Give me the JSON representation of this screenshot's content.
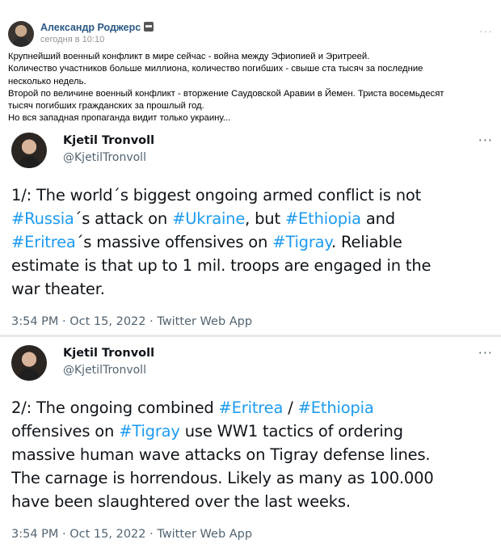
{
  "post": {
    "author": "Александр Роджерс",
    "time": "сегодня в 10:10",
    "more": "···",
    "text": [
      "Крупнейший военный конфликт в мире сейчас - война между Эфиопией и Эритреей.",
      "Количество участников больше миллиона, количество погибших - свыше ста тысяч за последние",
      "несколько недель.",
      "Второй по величине военный конфликт - вторжение Саудовской Аравии в Йемен. Триста восемьдесят",
      "тысяч погибших гражданских за прошлый год.",
      "Но вся западная пропаганда видит только украину..."
    ]
  },
  "tweets": [
    {
      "name": "Kjetil Tronvoll",
      "handle": "@KjetilTronvoll",
      "more": "···",
      "lines": [
        [
          {
            "t": "1/: The world´s biggest ongoing armed conflict is not",
            "tag": false
          }
        ],
        [
          {
            "t": "#Russia",
            "tag": true
          },
          {
            "t": "´s attack on ",
            "tag": false
          },
          {
            "t": "#Ukraine",
            "tag": true
          },
          {
            "t": ", but ",
            "tag": false
          },
          {
            "t": "#Ethiopia",
            "tag": true
          },
          {
            "t": " and",
            "tag": false
          }
        ],
        [
          {
            "t": "#Eritrea",
            "tag": true
          },
          {
            "t": "´s massive offensives on ",
            "tag": false
          },
          {
            "t": "#Tigray",
            "tag": true
          },
          {
            "t": ". Reliable",
            "tag": false
          }
        ],
        [
          {
            "t": "estimate is that up to 1 mil. troops are engaged in the",
            "tag": false
          }
        ],
        [
          {
            "t": "war theater.",
            "tag": false
          }
        ]
      ],
      "meta": "3:54 PM · Oct 15, 2022 · Twitter Web App"
    },
    {
      "name": "Kjetil Tronvoll",
      "handle": "@KjetilTronvoll",
      "more": "···",
      "lines": [
        [
          {
            "t": "2/: The ongoing combined ",
            "tag": false
          },
          {
            "t": "#Eritrea",
            "tag": true
          },
          {
            "t": " / ",
            "tag": false
          },
          {
            "t": "#Ethiopia",
            "tag": true
          }
        ],
        [
          {
            "t": "offensives on ",
            "tag": false
          },
          {
            "t": "#Tigray",
            "tag": true
          },
          {
            "t": " use WW1 tactics of ordering",
            "tag": false
          }
        ],
        [
          {
            "t": "massive human wave attacks on Tigray defense lines.",
            "tag": false
          }
        ],
        [
          {
            "t": "The carnage is horrendous. Likely as many as 100.000",
            "tag": false
          }
        ],
        [
          {
            "t": "have been slaughtered over the last weeks.",
            "tag": false
          }
        ]
      ],
      "meta": "3:54 PM · Oct 15, 2022 · Twitter Web App"
    }
  ]
}
